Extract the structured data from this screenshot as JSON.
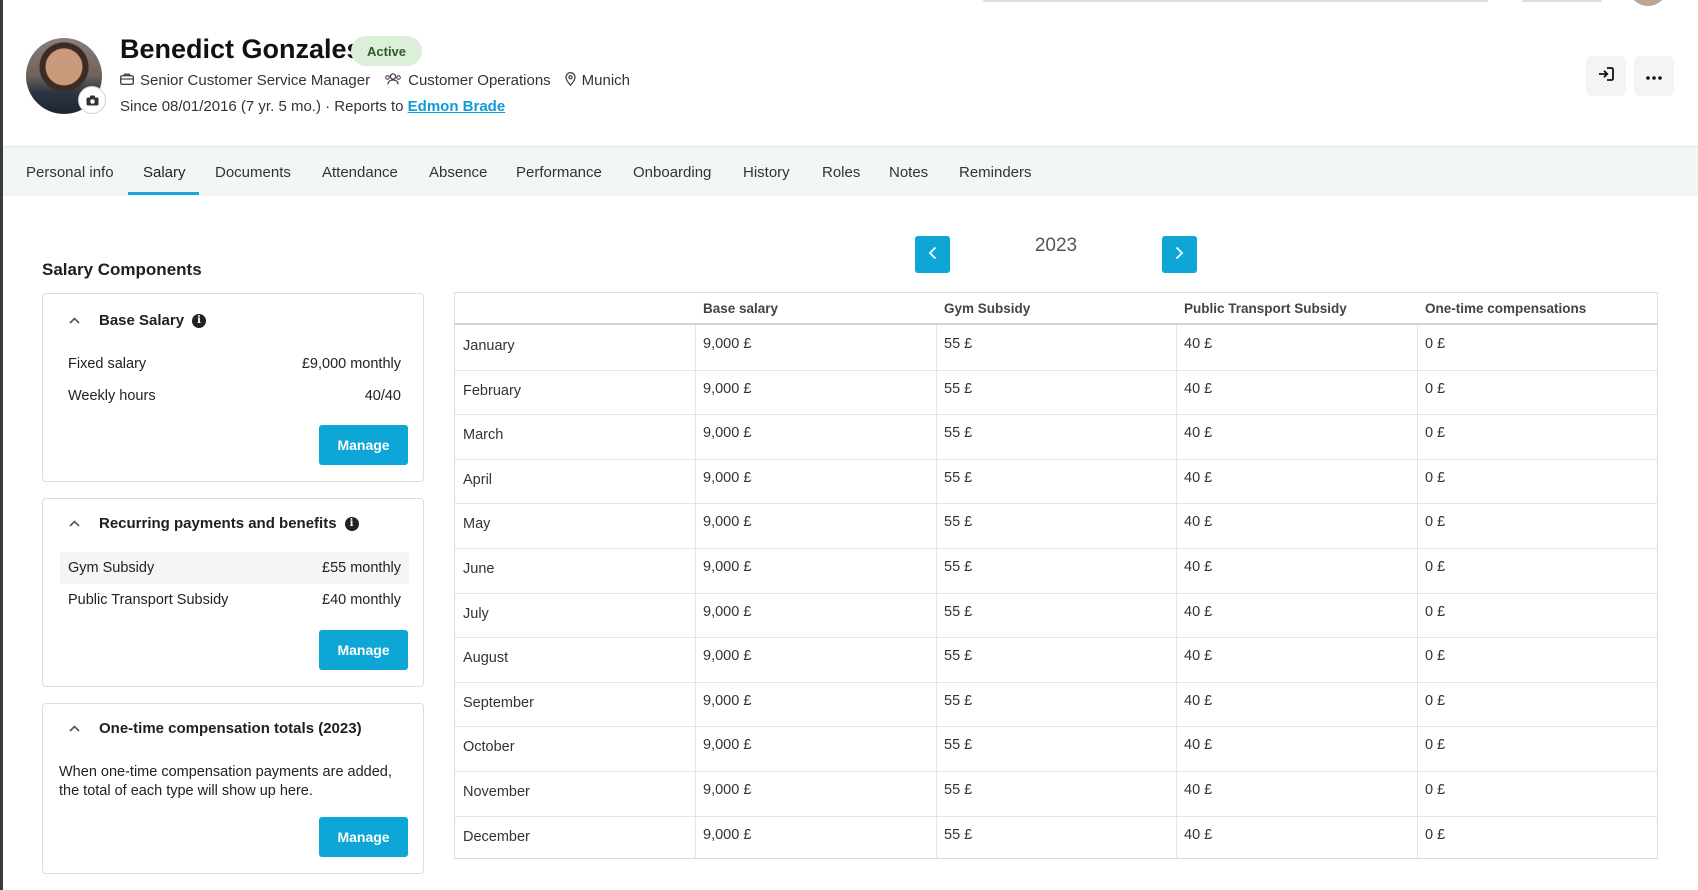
{
  "employee": {
    "name": "Benedict Gonzales",
    "status": "Active",
    "job_title": "Senior Customer Service Manager",
    "department": "Customer Operations",
    "location": "Munich",
    "since_text": "Since 08/01/2016 (7 yr. 5 mo.)",
    "reports_to_label": "· Reports to",
    "manager": "Edmon Brade"
  },
  "header_actions": {
    "login_icon": "sign-in-icon",
    "more_icon": "more-horizontal-icon"
  },
  "tabs": [
    {
      "label": "Personal info"
    },
    {
      "label": "Salary",
      "active": true
    },
    {
      "label": "Documents"
    },
    {
      "label": "Attendance"
    },
    {
      "label": "Absence"
    },
    {
      "label": "Performance"
    },
    {
      "label": "Onboarding"
    },
    {
      "label": "History"
    },
    {
      "label": "Roles"
    },
    {
      "label": "Notes"
    },
    {
      "label": "Reminders"
    }
  ],
  "year_nav": {
    "year": "2023",
    "prev_icon": "chevron-left-icon",
    "next_icon": "chevron-right-icon"
  },
  "components": {
    "title": "Salary Components",
    "base_salary": {
      "title": "Base Salary",
      "rows": [
        {
          "label": "Fixed salary",
          "value": "£9,000 monthly"
        },
        {
          "label": "Weekly hours",
          "value": "40/40"
        }
      ],
      "manage": "Manage"
    },
    "recurring": {
      "title": "Recurring payments and benefits",
      "rows": [
        {
          "label": "Gym Subsidy",
          "value": "£55 monthly"
        },
        {
          "label": "Public Transport Subsidy",
          "value": "£40 monthly"
        }
      ],
      "manage": "Manage"
    },
    "one_time": {
      "title": "One-time compensation totals (2023)",
      "text": "When one-time compensation payments are added, the total of each type will show up here.",
      "manage": "Manage"
    }
  },
  "table": {
    "columns": [
      "",
      "Base salary",
      "Gym Subsidy",
      "Public Transport Subsidy",
      "One-time compensations"
    ],
    "rows": [
      {
        "month": "January",
        "base": "9,000 £",
        "gym": "55 £",
        "transport": "40 £",
        "onetime": "0 £"
      },
      {
        "month": "February",
        "base": "9,000 £",
        "gym": "55 £",
        "transport": "40 £",
        "onetime": "0 £"
      },
      {
        "month": "March",
        "base": "9,000 £",
        "gym": "55 £",
        "transport": "40 £",
        "onetime": "0 £"
      },
      {
        "month": "April",
        "base": "9,000 £",
        "gym": "55 £",
        "transport": "40 £",
        "onetime": "0 £"
      },
      {
        "month": "May",
        "base": "9,000 £",
        "gym": "55 £",
        "transport": "40 £",
        "onetime": "0 £"
      },
      {
        "month": "June",
        "base": "9,000 £",
        "gym": "55 £",
        "transport": "40 £",
        "onetime": "0 £"
      },
      {
        "month": "July",
        "base": "9,000 £",
        "gym": "55 £",
        "transport": "40 £",
        "onetime": "0 £"
      },
      {
        "month": "August",
        "base": "9,000 £",
        "gym": "55 £",
        "transport": "40 £",
        "onetime": "0 £"
      },
      {
        "month": "September",
        "base": "9,000 £",
        "gym": "55 £",
        "transport": "40 £",
        "onetime": "0 £"
      },
      {
        "month": "October",
        "base": "9,000 £",
        "gym": "55 £",
        "transport": "40 £",
        "onetime": "0 £"
      },
      {
        "month": "November",
        "base": "9,000 £",
        "gym": "55 £",
        "transport": "40 £",
        "onetime": "0 £"
      },
      {
        "month": "December",
        "base": "9,000 £",
        "gym": "55 £",
        "transport": "40 £",
        "onetime": "0 £"
      }
    ]
  },
  "colors": {
    "accent": "#0ea5d7",
    "badge_bg": "#dcefd9",
    "link": "#0f9bd8"
  }
}
